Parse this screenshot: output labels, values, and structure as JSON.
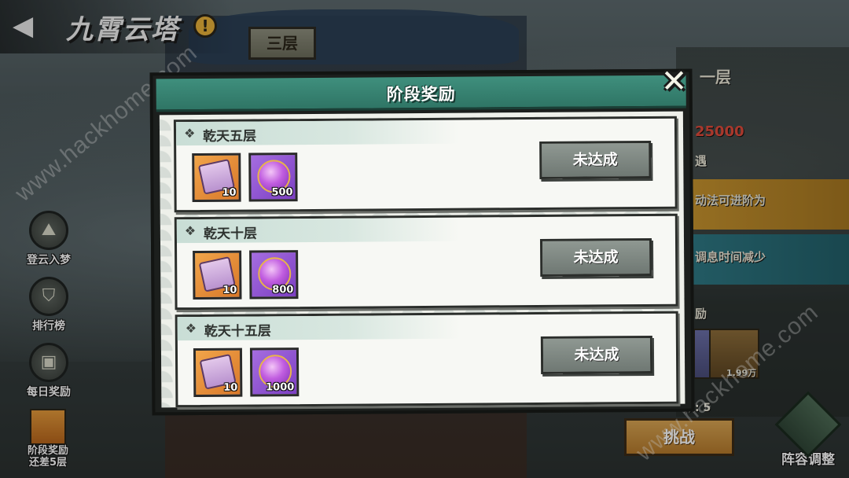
{
  "header": {
    "back_icon": "back-arrow-icon",
    "title": "九霄云塔",
    "info_icon": "exclamation-icon",
    "floor_plaque": "三层"
  },
  "sidebar": {
    "items": [
      {
        "label": "登云入梦",
        "icon": "mountain-icon"
      },
      {
        "label": "排行榜",
        "icon": "shield-icon"
      },
      {
        "label": "每日奖励",
        "icon": "chest-icon"
      },
      {
        "label": "阶段奖励\n还差5层",
        "line1": "阶段奖励",
        "line2": "还差5层",
        "icon": "scroll-icon"
      }
    ]
  },
  "right_panel": {
    "floor_label": "一层",
    "power_value": "25000",
    "section_encounter": "遇",
    "buff_1": "动法可进阶为",
    "buff_2": "调息时间减少",
    "section_reward": "励",
    "item_count": "1.99万",
    "remaining_label": "数: 5",
    "challenge_button": "挑战",
    "lineup_button": "阵容调整"
  },
  "watermark": "www.hackhome.com",
  "modal": {
    "title": "阶段奖励",
    "close_icon": "close-icon",
    "rewards": [
      {
        "title": "乾天五层",
        "items": [
          {
            "type": "scroll",
            "count": "10"
          },
          {
            "type": "orb",
            "count": "500"
          }
        ],
        "status": "未达成"
      },
      {
        "title": "乾天十层",
        "items": [
          {
            "type": "scroll",
            "count": "10"
          },
          {
            "type": "orb",
            "count": "800"
          }
        ],
        "status": "未达成"
      },
      {
        "title": "乾天十五层",
        "items": [
          {
            "type": "scroll",
            "count": "10"
          },
          {
            "type": "orb",
            "count": "1000"
          }
        ],
        "status": "未达成"
      }
    ]
  },
  "colors": {
    "header_teal": "#3f8f7d",
    "button_gray": "#7f8883",
    "scroll_orange": "#e8913a",
    "orb_purple": "#9556d4",
    "power_red": "#e24b3b"
  }
}
